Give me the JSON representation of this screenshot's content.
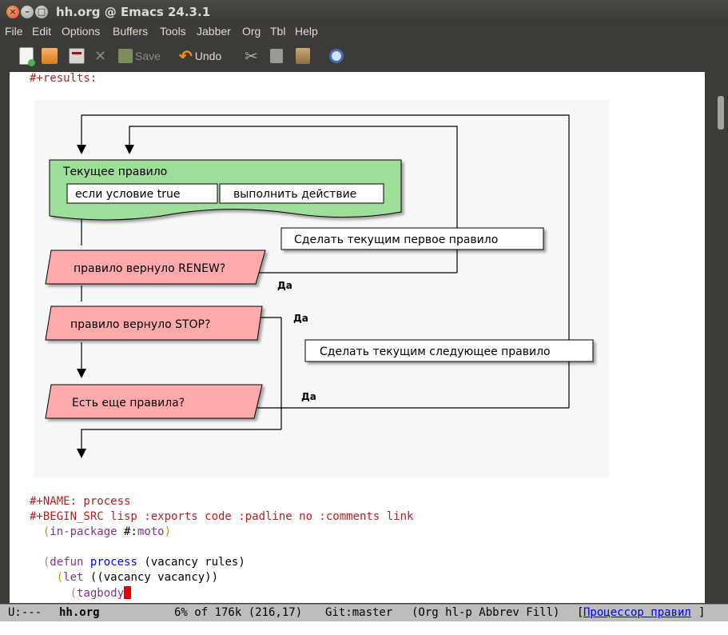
{
  "window": {
    "title": "hh.org @ Emacs 24.3.1"
  },
  "menubar": [
    "File",
    "Edit",
    "Options",
    "Buffers",
    "Tools",
    "Jabber",
    "Org",
    "Tbl",
    "Help"
  ],
  "toolbar": {
    "save_label": "Save",
    "undo_label": "Undo"
  },
  "buffer": {
    "results_line": "#+results:",
    "name_line": "#+NAME: process",
    "begin_src_line": "#+BEGIN_SRC lisp :exports code :padline no :comments link",
    "code": {
      "l1_paren_open": "(",
      "l1_kw": "in-package",
      "l1_rest": " #:",
      "l1_pkg": "moto",
      "l1_close": ")",
      "l2_open": "(",
      "l2_kw": "defun",
      "l2_fn": "process",
      "l2_args": "(vacancy rules)",
      "l3_open": "(",
      "l3_kw": "let",
      "l3_rest": "((vacancy vacancy))",
      "l4_open": "(",
      "l4_kw": "tagbody"
    }
  },
  "diagram": {
    "current_rule_title": "Текущее правило",
    "if_cond": "если условие true",
    "do_action": "выполнить действие",
    "make_first": "Сделать текущим первое правило",
    "renew_q": "правило вернуло RENEW?",
    "stop_q": "правило вернуло STOP?",
    "make_next": "Сделать текущим следующее правило",
    "more_rules_q": "Есть еще правила?",
    "yes1": "Да",
    "yes2": "Да",
    "yes3": "Да"
  },
  "modeline": {
    "status": "U:---",
    "buffer_name": "hh.org",
    "position": "6% of 176k (216,17)",
    "vcs": "Git:master",
    "modes": "(Org hl-p Abbrev Fill)",
    "bracket_open": "[",
    "heading": "Процессор правил",
    "bracket_close": "]"
  },
  "colors": {
    "keyword": "#b22222",
    "function": "#0000ff",
    "paren": "#b59a00",
    "builtin": "#7a378b",
    "diag_green": "#9edd9a",
    "diag_red": "#ffaaaa"
  }
}
